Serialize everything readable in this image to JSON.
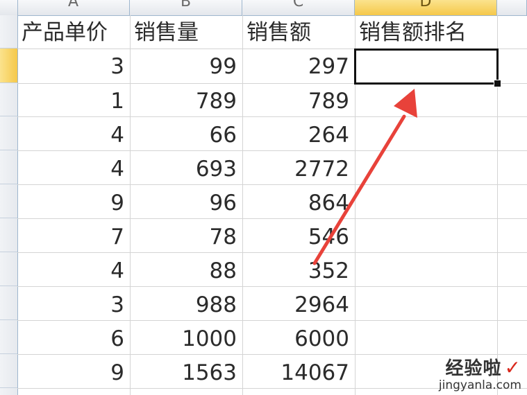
{
  "columns": [
    {
      "letter": "A",
      "selected": false
    },
    {
      "letter": "B",
      "selected": false
    },
    {
      "letter": "C",
      "selected": false
    },
    {
      "letter": "D",
      "selected": true
    }
  ],
  "headers": {
    "price": "产品单价",
    "volume": "销售量",
    "revenue": "销售额",
    "rank": "销售额排名"
  },
  "rows": [
    {
      "price": "3",
      "volume": "99",
      "revenue": "297",
      "rank": ""
    },
    {
      "price": "1",
      "volume": "789",
      "revenue": "789",
      "rank": ""
    },
    {
      "price": "4",
      "volume": "66",
      "revenue": "264",
      "rank": ""
    },
    {
      "price": "4",
      "volume": "693",
      "revenue": "2772",
      "rank": ""
    },
    {
      "price": "9",
      "volume": "96",
      "revenue": "864",
      "rank": ""
    },
    {
      "price": "7",
      "volume": "78",
      "revenue": "546",
      "rank": ""
    },
    {
      "price": "4",
      "volume": "88",
      "revenue": "352",
      "rank": ""
    },
    {
      "price": "3",
      "volume": "988",
      "revenue": "2964",
      "rank": ""
    },
    {
      "price": "6",
      "volume": "1000",
      "revenue": "6000",
      "rank": ""
    },
    {
      "price": "9",
      "volume": "1563",
      "revenue": "14067",
      "rank": ""
    }
  ],
  "active_cell": "D2",
  "watermark": {
    "brand": "经验啦",
    "check": "✓",
    "url": "jingyanla.com"
  },
  "colors": {
    "selection_header": "#f5c84a",
    "grid": "#d4d4d4",
    "arrow": "#e8423a"
  }
}
